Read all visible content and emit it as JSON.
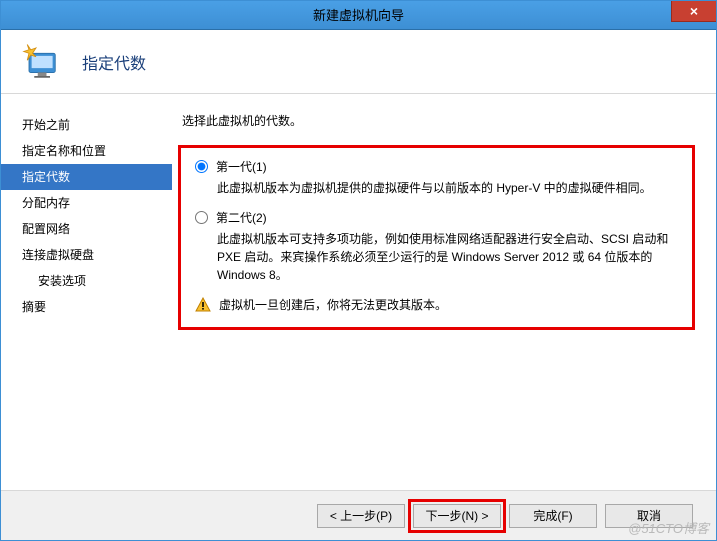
{
  "window": {
    "title": "新建虚拟机向导",
    "close_label": "×"
  },
  "header": {
    "page_title": "指定代数"
  },
  "sidebar": {
    "items": [
      {
        "label": "开始之前",
        "active": false
      },
      {
        "label": "指定名称和位置",
        "active": false
      },
      {
        "label": "指定代数",
        "active": true
      },
      {
        "label": "分配内存",
        "active": false
      },
      {
        "label": "配置网络",
        "active": false
      },
      {
        "label": "连接虚拟硬盘",
        "active": false
      },
      {
        "label": "安装选项",
        "active": false,
        "indent": true
      },
      {
        "label": "摘要",
        "active": false
      }
    ]
  },
  "main": {
    "instruction": "选择此虚拟机的代数。",
    "options": [
      {
        "value": "gen1",
        "label": "第一代(1)",
        "checked": true,
        "desc": "此虚拟机版本为虚拟机提供的虚拟硬件与以前版本的 Hyper-V 中的虚拟硬件相同。"
      },
      {
        "value": "gen2",
        "label": "第二代(2)",
        "checked": false,
        "desc": "此虚拟机版本可支持多项功能，例如使用标准网络适配器进行安全启动、SCSI 启动和 PXE 启动。来宾操作系统必须至少运行的是 Windows Server 2012 或 64 位版本的 Windows 8。"
      }
    ],
    "warning": "虚拟机一旦创建后，你将无法更改其版本。"
  },
  "footer": {
    "prev": "< 上一步(P)",
    "next": "下一步(N) >",
    "finish": "完成(F)",
    "cancel": "取消"
  },
  "watermark": "@51CTO博客"
}
